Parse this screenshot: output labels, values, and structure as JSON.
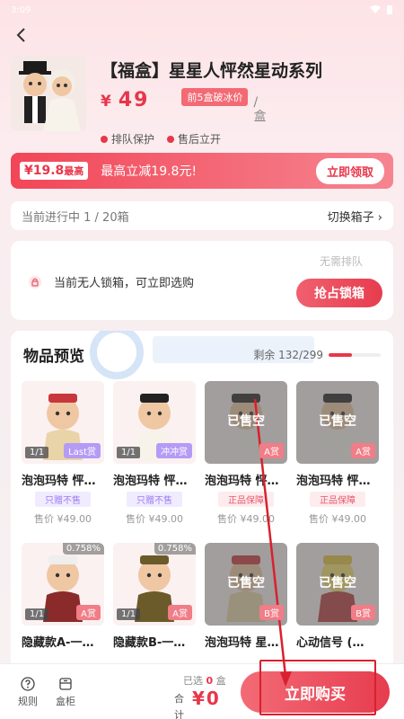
{
  "status": {
    "time": "3:09"
  },
  "product": {
    "title": "【福盒】星星人怦然星动系列",
    "price_symbol": "¥",
    "price_value": "49",
    "discount_badge": "前5盒破冰价",
    "unit": "/盒",
    "tags": [
      "排队保护",
      "售后立开"
    ]
  },
  "promo": {
    "badge_amount": "¥19.8",
    "badge_suffix": "最高",
    "text": "最高立减19.8元!",
    "button": "立即领取"
  },
  "progress": {
    "label": "当前进行中  1 / 20箱",
    "switch": "切换箱子"
  },
  "lock": {
    "text": "当前无人锁箱，可立即选购",
    "no_queue": "无需排队",
    "button": "抢占锁箱"
  },
  "preview": {
    "title": "物品预览",
    "remaining": "剩余 132/299",
    "remaining_fraction": 0.44,
    "items": [
      {
        "name": "泡泡玛特 怦…",
        "count": "1/1",
        "grade": "Last赏",
        "grade_style": "purple",
        "sold": false,
        "sold_label": "",
        "prob": "",
        "tag": "只赠不售",
        "tag_style": "purple",
        "price": "售价 ¥49.00"
      },
      {
        "name": "泡泡玛特 怦…",
        "count": "1/1",
        "grade": "冲冲赏",
        "grade_style": "purple",
        "sold": false,
        "sold_label": "",
        "prob": "",
        "tag": "只赠不售",
        "tag_style": "purple",
        "price": "售价 ¥49.00"
      },
      {
        "name": "泡泡玛特 怦…",
        "count": "",
        "grade": "A赏",
        "grade_style": "red",
        "sold": true,
        "sold_label": "已售空",
        "prob": "",
        "tag": "正品保障",
        "tag_style": "red",
        "price": "售价 ¥49.00"
      },
      {
        "name": "泡泡玛特 怦…",
        "count": "",
        "grade": "A赏",
        "grade_style": "red",
        "sold": true,
        "sold_label": "已售空",
        "prob": "",
        "tag": "正品保障",
        "tag_style": "red",
        "price": "售价 ¥49.00"
      },
      {
        "name": "隐藏款A-一…",
        "count": "1/1",
        "grade": "A赏",
        "grade_style": "red",
        "sold": false,
        "sold_label": "",
        "prob": "0.758%",
        "tag": "",
        "tag_style": "",
        "price": ""
      },
      {
        "name": "隐藏款B-一…",
        "count": "1/1",
        "grade": "A赏",
        "grade_style": "red",
        "sold": false,
        "sold_label": "",
        "prob": "0.758%",
        "tag": "",
        "tag_style": "",
        "price": ""
      },
      {
        "name": "泡泡玛特 星…",
        "count": "",
        "grade": "B赏",
        "grade_style": "red",
        "sold": true,
        "sold_label": "已售空",
        "prob": "",
        "tag": "",
        "tag_style": "",
        "price": ""
      },
      {
        "name": "心动信号 (…",
        "count": "",
        "grade": "B赏",
        "grade_style": "red",
        "sold": true,
        "sold_label": "已售空",
        "prob": "",
        "tag": "",
        "tag_style": "",
        "price": ""
      }
    ]
  },
  "bottom": {
    "rules": "规则",
    "cabinet": "盒柜",
    "selected_prefix": "已选",
    "selected_count": "0",
    "selected_suffix": "盒",
    "total_label": "合计",
    "total_value": "¥0",
    "buy_button": "立即购买"
  },
  "colors": {
    "accent": "#e8364a",
    "purple": "#b59bf6"
  }
}
